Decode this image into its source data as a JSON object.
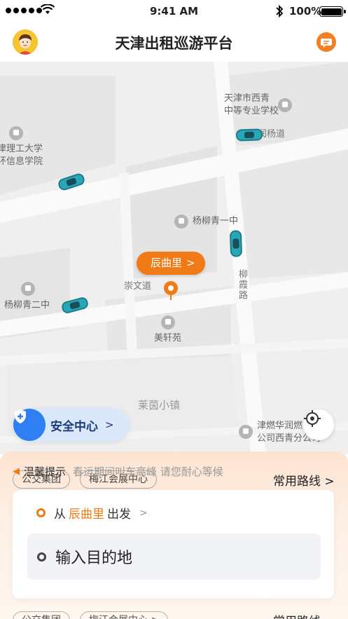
{
  "status_bar": {
    "time": "9:41 AM",
    "battery": "100%",
    "icons": [
      "signal-icon",
      "wifi-icon",
      "bluetooth-icon",
      "battery-icon"
    ]
  },
  "header": {
    "title": "天津出租巡游平台",
    "avatar": "avatar",
    "message_icon": "message-icon"
  },
  "map": {
    "pois": {
      "school_xiqing": "天津市西青\n中等专业学校",
      "road_runyang": "润杨道",
      "tech_college": "津理工大学\n环信息学院",
      "yangliuqing_1": "杨柳青一中",
      "road_liulu": "柳霞路",
      "road_chongwen": "崇文道",
      "yangliuqing_2": "杨柳青二中",
      "meixuanyuan": "美轩苑",
      "laiyin": "莱茵小镇",
      "gas_company": "津燃华润燃\n公司西青分公司"
    },
    "pickup": {
      "label": "辰曲里",
      "arrow": ">"
    },
    "safety": {
      "label": "安全中心",
      "arrow": ">"
    },
    "colors": {
      "accent": "#f07a15",
      "safety_blue": "#2f7ff2",
      "car_teal": "#2aa7b6"
    }
  },
  "sheet": {
    "notice_title": "温馨提示",
    "notice_text": "春运期间叫车高峰 请您耐心等候",
    "chips": [
      "公交集团",
      "梅江会展中心"
    ],
    "common_routes": "常用路线 >",
    "ghost_routes": "常用路线",
    "from_prefix": "从",
    "from_place": "辰曲里",
    "from_suffix": "出发",
    "from_arrow": ">",
    "destination_placeholder": "输入目的地",
    "ghost_chips": [
      "公交集团",
      "梅江会展中心 >"
    ]
  }
}
